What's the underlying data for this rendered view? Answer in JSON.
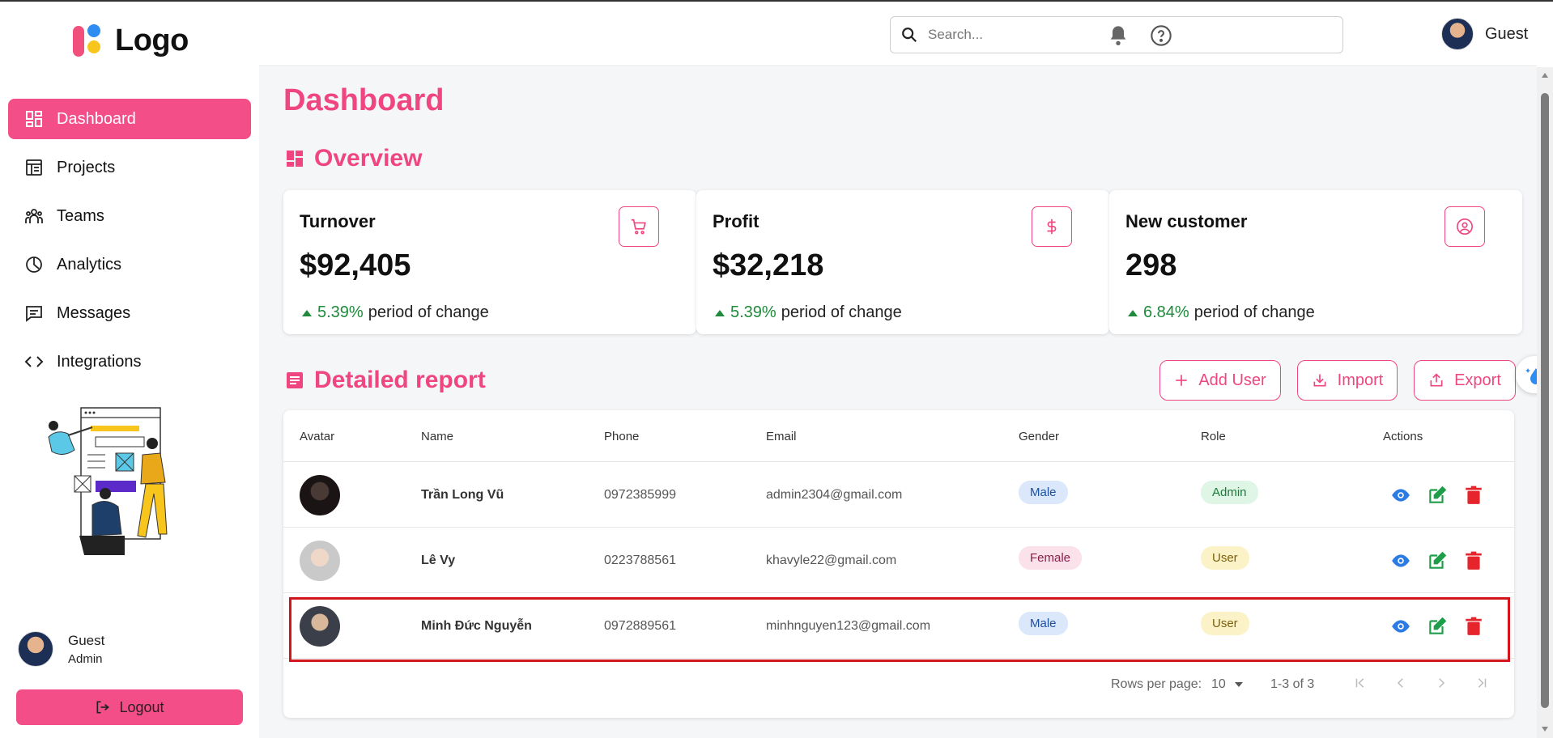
{
  "brand": {
    "logo_text": "Logo"
  },
  "sidebar": {
    "items": [
      {
        "label": "Dashboard",
        "icon": "dashboard-icon",
        "active": true
      },
      {
        "label": "Projects",
        "icon": "projects-icon"
      },
      {
        "label": "Teams",
        "icon": "teams-icon"
      },
      {
        "label": "Analytics",
        "icon": "analytics-icon"
      },
      {
        "label": "Messages",
        "icon": "messages-icon"
      },
      {
        "label": "Integrations",
        "icon": "integrations-icon"
      }
    ],
    "user": {
      "name": "Guest",
      "role": "Admin"
    },
    "logout_label": "Logout"
  },
  "header": {
    "search_placeholder": "Search...",
    "user_name": "Guest"
  },
  "main": {
    "title": "Dashboard",
    "overview_title": "Overview",
    "cards": [
      {
        "title": "Turnover",
        "value": "$92,405",
        "change": "5.39%",
        "change_text": "period of change",
        "icon": "cart-icon"
      },
      {
        "title": "Profit",
        "value": "$32,218",
        "change": "5.39%",
        "change_text": "period of change",
        "icon": "dollar-icon"
      },
      {
        "title": "New customer",
        "value": "298",
        "change": "6.84%",
        "change_text": "period of change",
        "icon": "user-circle-icon"
      }
    ],
    "report_title": "Detailed report",
    "actions": {
      "add_user": "Add User",
      "import": "Import",
      "export": "Export"
    },
    "table": {
      "columns": [
        "Avatar",
        "Name",
        "Phone",
        "Email",
        "Gender",
        "Role",
        "Actions"
      ],
      "rows": [
        {
          "name": "Trần Long Vũ",
          "phone": "0972385999",
          "email": "admin2304@gmail.com",
          "gender": "Male",
          "role": "Admin"
        },
        {
          "name": "Lê Vy",
          "phone": "0223788561",
          "email": "khavyle22@gmail.com",
          "gender": "Female",
          "role": "User"
        },
        {
          "name": "Minh Đức Nguyễn",
          "phone": "0972889561",
          "email": "minhnguyen123@gmail.com",
          "gender": "Male",
          "role": "User"
        }
      ]
    },
    "pagination": {
      "rows_per_page_label": "Rows per page:",
      "rows_per_page": "10",
      "range": "1-3 of 3"
    }
  },
  "colors": {
    "accent": "#f0467f",
    "accent_fill": "#f34e87",
    "positive": "#1f8a3b",
    "highlight": "#d3161c"
  }
}
